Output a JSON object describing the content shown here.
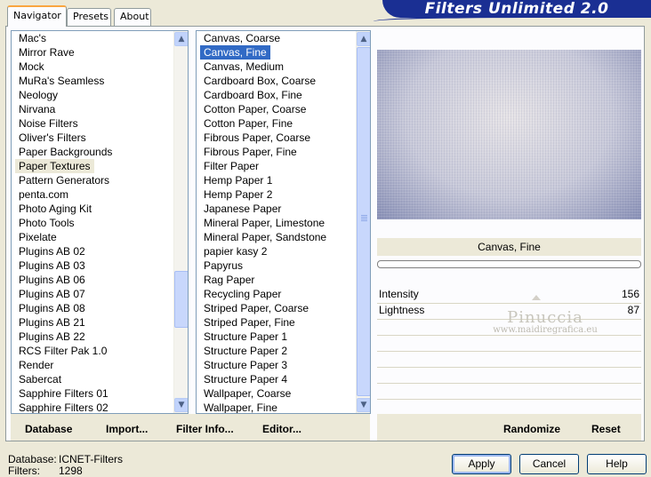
{
  "tabs": [
    {
      "label": "Navigator",
      "active": true
    },
    {
      "label": "Presets",
      "active": false
    },
    {
      "label": "About",
      "active": false
    }
  ],
  "header": {
    "title": "Filters Unlimited 2.0"
  },
  "categories": [
    "Mac's",
    "Mirror Rave",
    "Mock",
    "MuRa's Seamless",
    "Neology",
    "Nirvana",
    "Noise Filters",
    "Oliver's Filters",
    "Paper Backgrounds",
    "Paper Textures",
    "Pattern Generators",
    "penta.com",
    "Photo Aging Kit",
    "Photo Tools",
    "Pixelate",
    "Plugins AB 02",
    "Plugins AB 03",
    "Plugins AB 06",
    "Plugins AB 07",
    "Plugins AB 08",
    "Plugins AB 21",
    "Plugins AB 22",
    "RCS Filter Pak 1.0",
    "Render",
    "Sabercat",
    "Sapphire Filters 01",
    "Sapphire Filters 02"
  ],
  "categories_selected_index": 9,
  "filters": [
    "Canvas, Coarse",
    "Canvas, Fine",
    "Canvas, Medium",
    "Cardboard Box, Coarse",
    "Cardboard Box, Fine",
    "Cotton Paper, Coarse",
    "Cotton Paper, Fine",
    "Fibrous Paper, Coarse",
    "Fibrous Paper, Fine",
    "Filter Paper",
    "Hemp Paper 1",
    "Hemp Paper 2",
    "Japanese Paper",
    "Mineral Paper, Limestone",
    "Mineral Paper, Sandstone",
    "papier kasy 2",
    "Papyrus",
    "Rag Paper",
    "Recycling Paper",
    "Striped Paper, Coarse",
    "Striped Paper, Fine",
    "Structure Paper 1",
    "Structure Paper 2",
    "Structure Paper 3",
    "Structure Paper 4",
    "Wallpaper, Coarse",
    "Wallpaper, Fine"
  ],
  "filters_selected_index": 1,
  "preview": {
    "filter_name": "Canvas, Fine",
    "params": [
      {
        "name": "Intensity",
        "value": "156"
      },
      {
        "name": "Lightness",
        "value": "87"
      }
    ]
  },
  "watermark": {
    "line1": "Pinuccia",
    "line2": "www.maidiregrafica.eu"
  },
  "toolbar": {
    "database": "Database",
    "import": "Import...",
    "filter_info": "Filter Info...",
    "editor": "Editor...",
    "randomize": "Randomize",
    "reset": "Reset"
  },
  "footer": {
    "database_label": "Database:",
    "database_value": "ICNET-Filters",
    "filters_label": "Filters:",
    "filters_value": "1298"
  },
  "buttons": {
    "apply": "Apply",
    "cancel": "Cancel",
    "help": "Help"
  }
}
